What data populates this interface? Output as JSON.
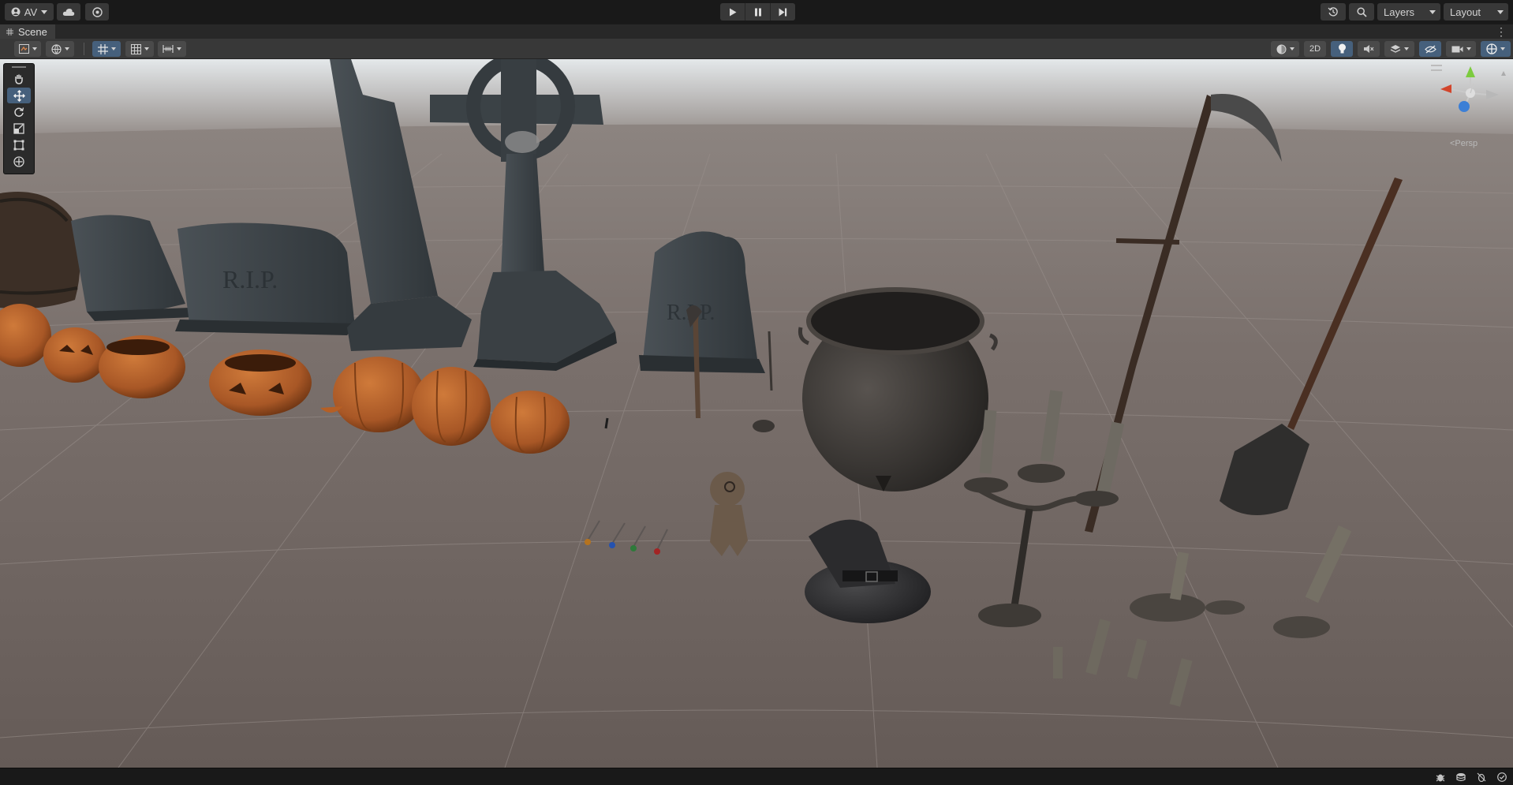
{
  "toolbar": {
    "account_label": "AV",
    "layers_label": "Layers",
    "layout_label": "Layout",
    "icons": [
      "account-icon",
      "cloud-icon",
      "collab-icon",
      "play-icon",
      "pause-icon",
      "step-icon",
      "history-icon",
      "search-icon"
    ]
  },
  "scene_tab": {
    "label": "Scene",
    "icon": "hash-grid-icon"
  },
  "scene_toolbar": {
    "mode_2d_label": "2D",
    "buttons": [
      "draw-mode",
      "shading-mode",
      "snap-grid",
      "grid-snapping",
      "increment-snap",
      "shading-sphere",
      "2d-toggle",
      "lighting-toggle",
      "audio-toggle",
      "effects-toggle",
      "hidden-objects-toggle",
      "camera-settings",
      "gizmos-toggle"
    ]
  },
  "tool_palette": {
    "tools": [
      "hand-tool",
      "move-tool",
      "rotate-tool",
      "scale-tool",
      "rect-tool",
      "transform-tool"
    ],
    "active_tool": "move-tool"
  },
  "orientation_gizmo": {
    "projection_label": "<Persp"
  },
  "scene": {
    "engraving": "R.I.P.",
    "colors": {
      "sky_top": "#d6dcdf",
      "horizon": "#8f8783",
      "ground_near": "#6e6460",
      "stone": "#3a4044",
      "pumpkin": "#b5642a",
      "iron": "#3a3836"
    }
  },
  "status_bar": {
    "icons": [
      "bug-icon",
      "cache-icon",
      "debug-off-icon",
      "check-icon"
    ]
  }
}
